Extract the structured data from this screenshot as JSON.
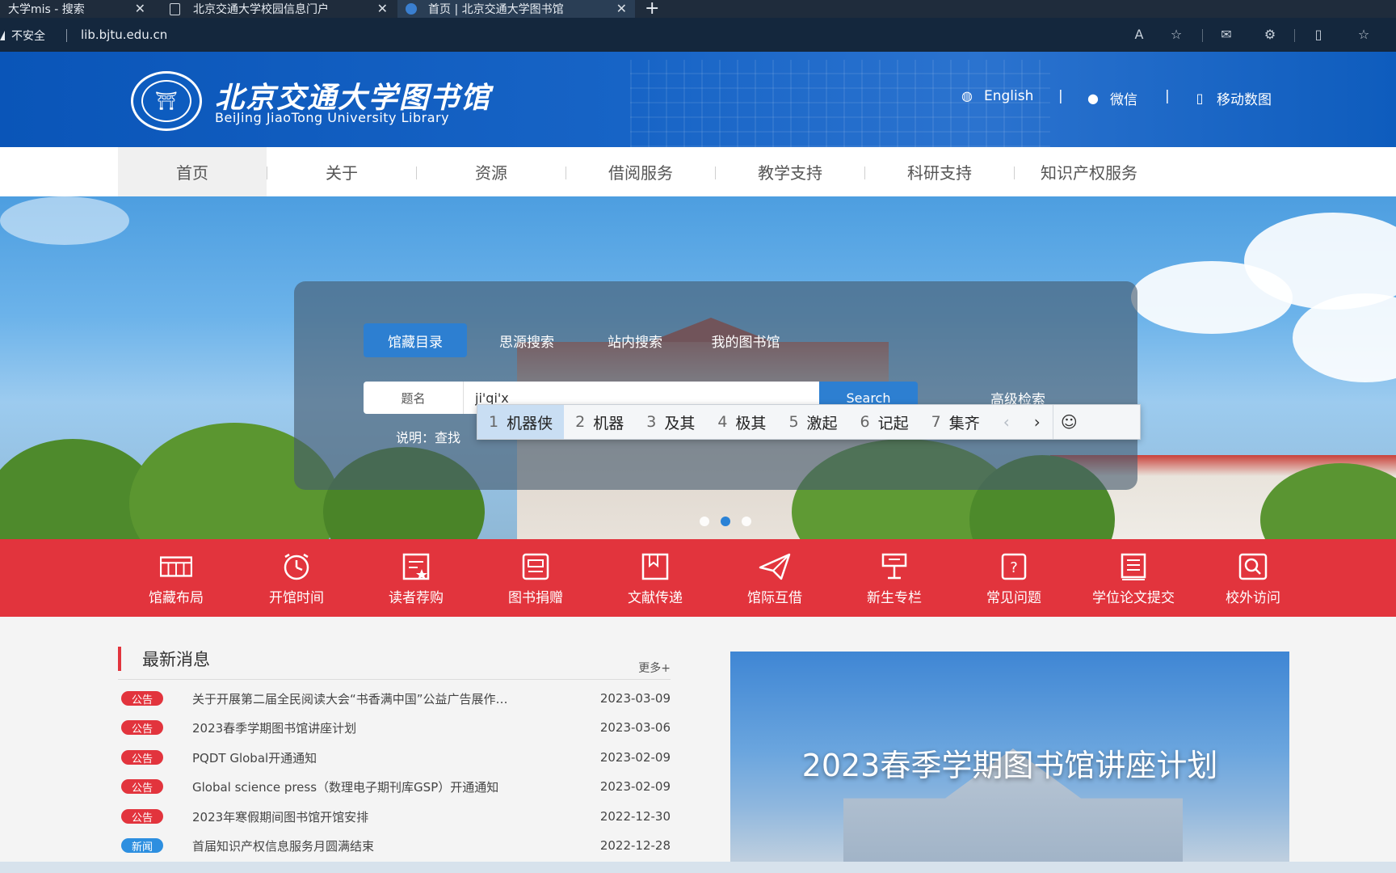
{
  "browser": {
    "tabs": [
      {
        "title": "大学mis - 搜索"
      },
      {
        "title": "北京交通大学校园信息门户"
      },
      {
        "title": "首页 | 北京交通大学图书馆"
      }
    ],
    "security_label": "不安全",
    "url": "lib.bjtu.edu.cn"
  },
  "header": {
    "logo_cn": "北京交通大学图书馆",
    "logo_en": "BeiJing JiaoTong University Library",
    "links": [
      {
        "label": "English",
        "icon": "globe-icon"
      },
      {
        "label": "微信",
        "icon": "wechat-icon"
      },
      {
        "label": "移动数图",
        "icon": "mobile-icon"
      }
    ],
    "separator": "|"
  },
  "nav": {
    "items": [
      "首页",
      "关于",
      "资源",
      "借阅服务",
      "教学支持",
      "科研支持",
      "知识产权服务"
    ],
    "active_index": 0
  },
  "search": {
    "tabs": [
      "馆藏目录",
      "思源搜索",
      "站内搜索",
      "我的图书馆"
    ],
    "active_tab": 0,
    "field_type": "题名",
    "input_value": "ji'qi'x",
    "button_label": "Search",
    "advanced_label": "高级检索",
    "note_label": "说明：查找"
  },
  "ime": {
    "candidates": [
      {
        "num": "1",
        "text": "机器侠"
      },
      {
        "num": "2",
        "text": "机器"
      },
      {
        "num": "3",
        "text": "及其"
      },
      {
        "num": "4",
        "text": "极其"
      },
      {
        "num": "5",
        "text": "激起"
      },
      {
        "num": "6",
        "text": "记起"
      },
      {
        "num": "7",
        "text": "集齐"
      }
    ],
    "selected_index": 0
  },
  "quick_links": [
    {
      "label": "馆藏布局",
      "icon": "layout-icon"
    },
    {
      "label": "开馆时间",
      "icon": "clock-icon"
    },
    {
      "label": "读者荐购",
      "icon": "recommend-icon"
    },
    {
      "label": "图书捐赠",
      "icon": "donate-icon"
    },
    {
      "label": "文献传递",
      "icon": "document-delivery-icon"
    },
    {
      "label": "馆际互借",
      "icon": "paper-plane-icon"
    },
    {
      "label": "新生专栏",
      "icon": "lectern-icon"
    },
    {
      "label": "常见问题",
      "icon": "question-icon"
    },
    {
      "label": "学位论文提交",
      "icon": "thesis-icon"
    },
    {
      "label": "校外访问",
      "icon": "remote-access-icon"
    }
  ],
  "news": {
    "title": "最新消息",
    "more_label": "更多+",
    "items": [
      {
        "badge": "公告",
        "badge_color": "red",
        "text": "关于开展第二届全民阅读大会“书香满中国”公益广告展作…",
        "date": "2023-03-09"
      },
      {
        "badge": "公告",
        "badge_color": "red",
        "text": "2023春季学期图书馆讲座计划",
        "date": "2023-03-06"
      },
      {
        "badge": "公告",
        "badge_color": "red",
        "text": "PQDT Global开通通知",
        "date": "2023-02-09"
      },
      {
        "badge": "公告",
        "badge_color": "red",
        "text": "Global science press（数理电子期刊库GSP）开通通知",
        "date": "2023-02-09"
      },
      {
        "badge": "公告",
        "badge_color": "red",
        "text": "2023年寒假期间图书馆开馆安排",
        "date": "2022-12-30"
      },
      {
        "badge": "新闻",
        "badge_color": "blue",
        "text": "首届知识产权信息服务月圆满结束",
        "date": "2022-12-28"
      }
    ]
  },
  "banner": {
    "caption": "2023春季学期图书馆讲座计划"
  },
  "colors": {
    "header_blue": "#0a55b8",
    "quick_red": "#e2343d",
    "search_blue": "#2d7fd1"
  }
}
